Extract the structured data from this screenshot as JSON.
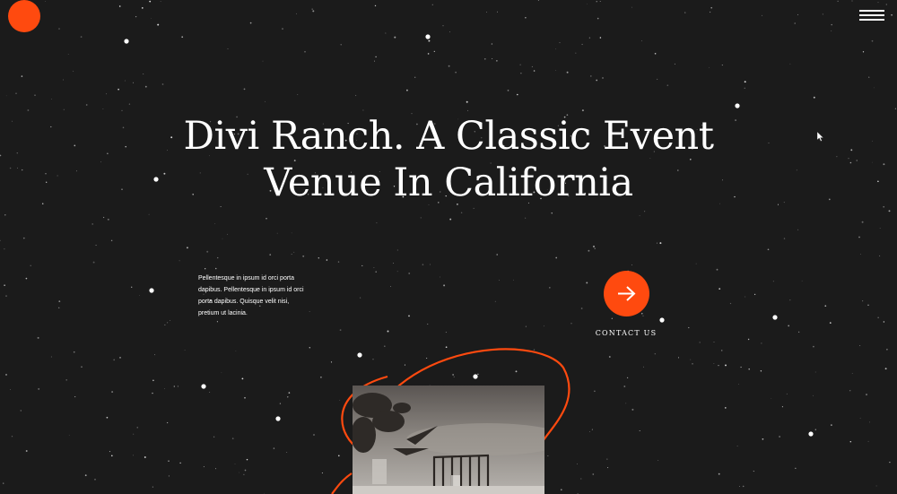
{
  "header": {
    "logo_icon": "orange-circle-logo",
    "menu_icon": "hamburger-menu-icon"
  },
  "hero": {
    "title": "Divi Ranch. A Classic Event Venue In California",
    "intro_text": "Pellentesque in ipsum id orci porta dapibus. Pellentesque in ipsum id orci porta dapibus. Quisque velit nisi, pretium ut lacinia.",
    "cta_label": "CONTACT US",
    "cta_icon": "arrow-right-icon"
  },
  "colors": {
    "background": "#1b1b1b",
    "accent": "#ff4a0f",
    "text": "#ffffff"
  }
}
